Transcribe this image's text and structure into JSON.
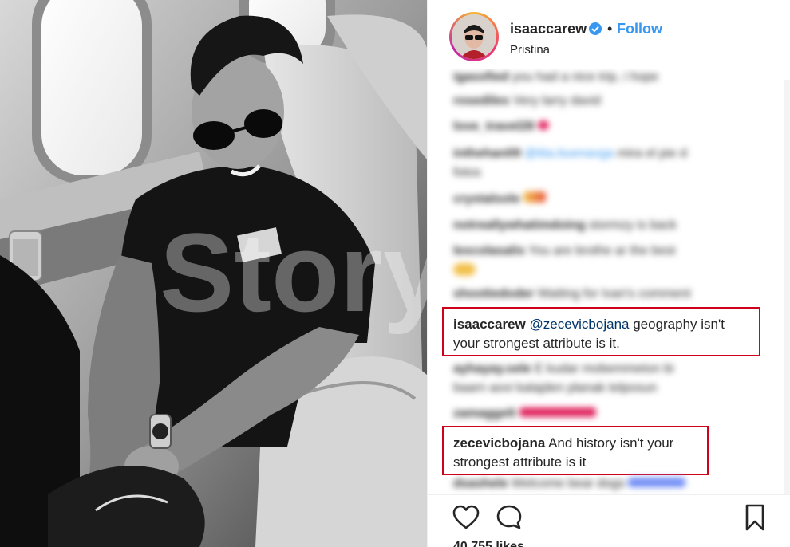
{
  "post": {
    "username": "isaaccarew",
    "follow_label": "Follow",
    "dot": "•",
    "location": "Pristina",
    "watermark": "Storyal",
    "likes": "40,755 likes"
  },
  "highlighted_comments": [
    {
      "user": "isaaccarew",
      "mention": "@zecevicbojana",
      "text_line1": " geography isn't",
      "text_line2": "your strongest attribute is it."
    },
    {
      "user": "zecevicbojana",
      "text_line1": " And history isn't your",
      "text_line2": "strongest attribute is it"
    }
  ],
  "icons": {
    "verified": "verified-badge-icon",
    "like": "heart-icon",
    "comment": "comment-bubble-icon",
    "save": "bookmark-icon"
  },
  "colors": {
    "follow": "#3897f0",
    "highlight_box": "#d0021b",
    "text": "#262626"
  }
}
